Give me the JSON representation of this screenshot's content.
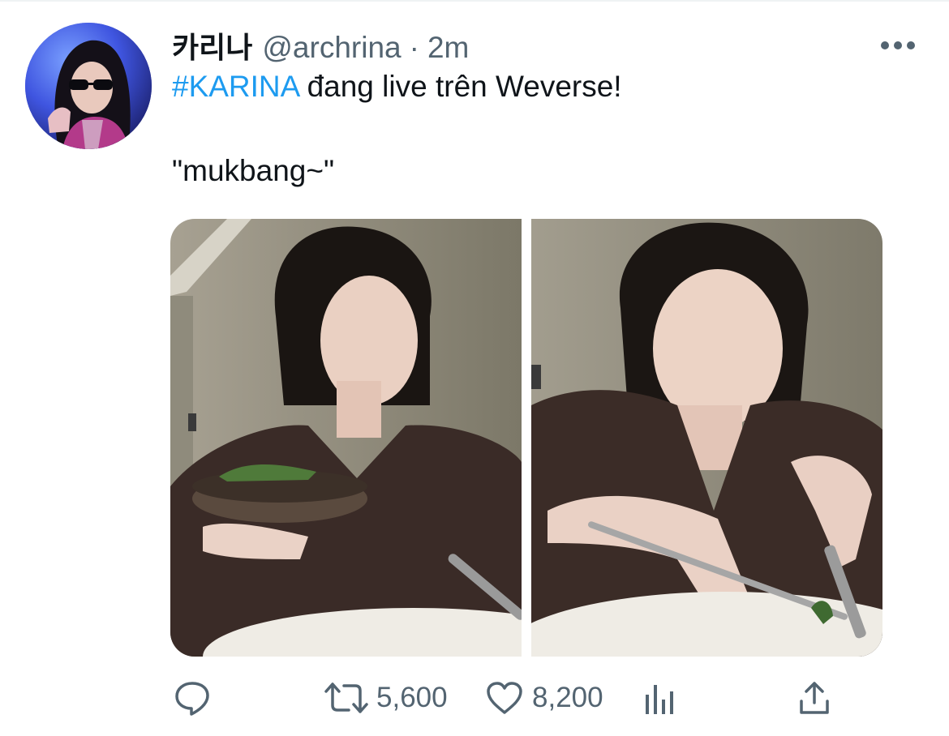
{
  "tweet": {
    "display_name": "카리나",
    "handle": "@archrina",
    "separator": "·",
    "time": "2m",
    "hashtag": "#KARINA",
    "text_rest": " đang live trên Weverse!",
    "quote": "\"mukbang~\""
  },
  "actions": {
    "retweet_count": "5,600",
    "like_count": "8,200"
  },
  "icons": {
    "reply": "reply-icon",
    "retweet": "retweet-icon",
    "like": "heart-icon",
    "analytics": "analytics-icon",
    "share": "share-icon",
    "more": "more-icon"
  },
  "colors": {
    "accent": "#1d9bf0",
    "secondary_text": "#536471",
    "primary_text": "#0f1419"
  }
}
